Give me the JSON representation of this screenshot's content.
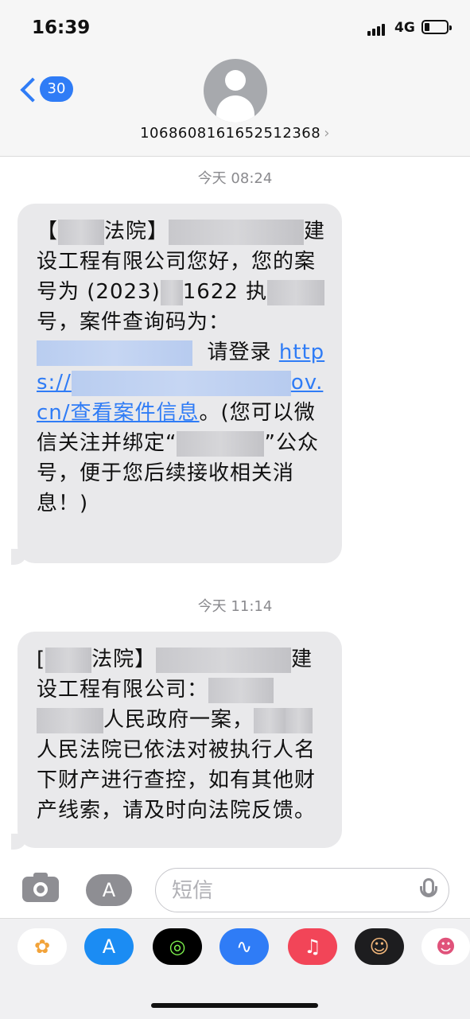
{
  "status_bar": {
    "time": "16:39",
    "network": "4G"
  },
  "header": {
    "back_count": "30",
    "contact_number": "1068608161652512368",
    "contact_arrow": "›"
  },
  "messages": [
    {
      "timestamp": "今天 08:24",
      "segments": {
        "s1": "【",
        "s2": "法院】",
        "s3": "建设工程有限公司您好，您的案号为 (2023)",
        "s4": "1622 执",
        "s5": "号，案件查询码为：",
        "s6": "请登录",
        "s7": "https://",
        "s8": "ov.cn/查看案件信息",
        "s9": "。(您可以微信关注并绑定“",
        "s10": "”公众号，便于您后续接收相关消息！)"
      }
    },
    {
      "timestamp": "今天 11:14",
      "segments": {
        "s1": "[",
        "s2": "法院】",
        "s3": "建设工程有限公司：",
        "s4": "人民政府一案，",
        "s5": "人民法院已依法对被执行人名下财产进行查控，如有其他财产线索，请及时向法院反馈。"
      }
    }
  ],
  "input_bar": {
    "placeholder": "短信",
    "apps_glyph": "A"
  },
  "app_drawer": {
    "items": [
      {
        "name": "photos",
        "glyph": "✿"
      },
      {
        "name": "app-store",
        "glyph": "A"
      },
      {
        "name": "activity",
        "glyph": "◎"
      },
      {
        "name": "voice-memo",
        "glyph": "∿"
      },
      {
        "name": "music",
        "glyph": "♫"
      },
      {
        "name": "memoji",
        "glyph": "☺"
      },
      {
        "name": "stickers",
        "glyph": "☻"
      }
    ]
  },
  "colors": {
    "accent": "#2f7cf6",
    "bubble": "#e9e9eb",
    "timestamp": "#8a8a8e"
  }
}
